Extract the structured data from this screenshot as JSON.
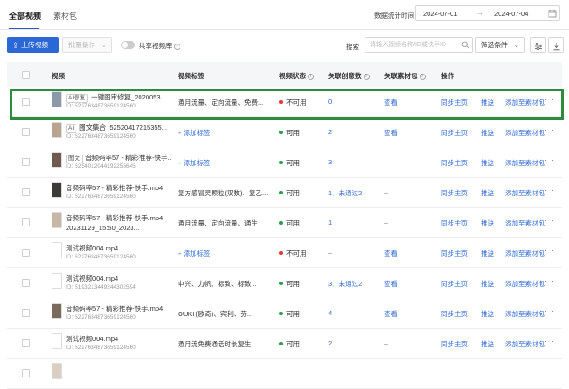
{
  "tabs": [
    {
      "label": "全部视频",
      "active": true
    },
    {
      "label": "素材包",
      "active": false
    }
  ],
  "date_range": {
    "label": "数据统计时间",
    "start": "2024-07-01",
    "end": "2024-07-04"
  },
  "toolbar": {
    "upload_label": "上传视频",
    "batch_label": "批量操作",
    "share_label": "共享视频库",
    "search_label": "搜索",
    "search_placeholder": "请输入视频名称/ID或快手ID",
    "filter_label": "筛选条件"
  },
  "columns": [
    "视频",
    "视频标签",
    "视频状态",
    "关联创意数",
    "关联素材包",
    "操作"
  ],
  "actions": {
    "sync": "同步主页",
    "push": "推送",
    "add": "添加至素材包",
    "more": "···"
  },
  "rows": [
    {
      "badge": "AI修复",
      "name": "一键图审修复_2020053...",
      "id": "ID: 5227634873659124560",
      "tags": "通用流量、定向流量、免费...",
      "status": "不可用",
      "status_color": "#e53935",
      "creatives": "0",
      "pack": "查看",
      "pack_link": true,
      "thumb": "#8a9aa8"
    },
    {
      "badge": "AI",
      "name": "图文集合_52520417215355...",
      "id": "ID: 5227634873659124560",
      "tags": "+ 添加标签",
      "tags_link": true,
      "status": "可用",
      "status_color": "#2e9d4e",
      "creatives": "2",
      "pack": "查看",
      "pack_link": true,
      "thumb": "#b9a58f"
    },
    {
      "badge": "图文",
      "name": "音频码率57 - 精彩推荐-快手...",
      "id": "ID: 5254012044192255645",
      "tags": "+ 添加标签",
      "tags_link": true,
      "status": "可用",
      "status_color": "#2e9d4e",
      "creatives": "3",
      "pack": "–",
      "pack_link": false,
      "thumb": "#6f5a4d"
    },
    {
      "badge": "",
      "name": "音频码率57 - 精彩推荐-快手.mp4",
      "id": "ID: 5227634873659124560",
      "tags": "复方感冒灵颗粒(双数)、复乙...",
      "status": "可用",
      "status_color": "#2e9d4e",
      "creatives": "1、未通过2",
      "pack": "–",
      "pack_link": false,
      "thumb": "#3d3a3a"
    },
    {
      "badge": "",
      "name": "音频码率57 - 精彩推荐-快手.mp4",
      "name2": "20231129_15:50_2023...",
      "id": "",
      "tags": "通用流量、定向流量、通生",
      "status": "可用",
      "status_color": "#2e9d4e",
      "creatives": "1",
      "pack": "–",
      "pack_link": false,
      "thumb": "#c9b7a6"
    },
    {
      "badge": "",
      "name": "测试视频004.mp4",
      "id": "ID: 5227634873659124560",
      "tags": "+ 添加标签",
      "tags_link": true,
      "status": "不可用",
      "status_color": "#e53935",
      "creatives": "–",
      "pack": "查看",
      "pack_link": true,
      "thumb": "#ffffff"
    },
    {
      "badge": "",
      "name": "测试视频004.mp4",
      "id": "ID: 5193213449244302594",
      "tags": "中兴、力帆、标致、标致...",
      "status": "可用",
      "status_color": "#2e9d4e",
      "creatives": "3、未通过2",
      "pack": "查看",
      "pack_link": true,
      "thumb": "#ffffff"
    },
    {
      "badge": "",
      "name": "音频码率57 - 精彩推荐-快手.mp4",
      "id": "ID: 5227634873659124560",
      "tags": "OUKI (欧奇)、宾利、劳...",
      "status": "可用",
      "status_color": "#2e9d4e",
      "creatives": "4",
      "pack": "查看",
      "pack_link": true,
      "thumb": "#7a6b5c"
    },
    {
      "badge": "",
      "name": "测试视频004.mp4",
      "id": "ID: 5227634873659124560",
      "tags": "通用流免费通话时长复生",
      "status": "可用",
      "status_color": "#2e9d4e",
      "creatives": "2",
      "pack": "–",
      "pack_link": false,
      "thumb": "#ffffff"
    },
    {
      "badge": "",
      "name": "",
      "id": "",
      "tags": "",
      "status": "",
      "status_color": "#2e9d4e",
      "creatives": "",
      "pack": "",
      "pack_link": false,
      "thumb": "#d9cfc4"
    }
  ]
}
